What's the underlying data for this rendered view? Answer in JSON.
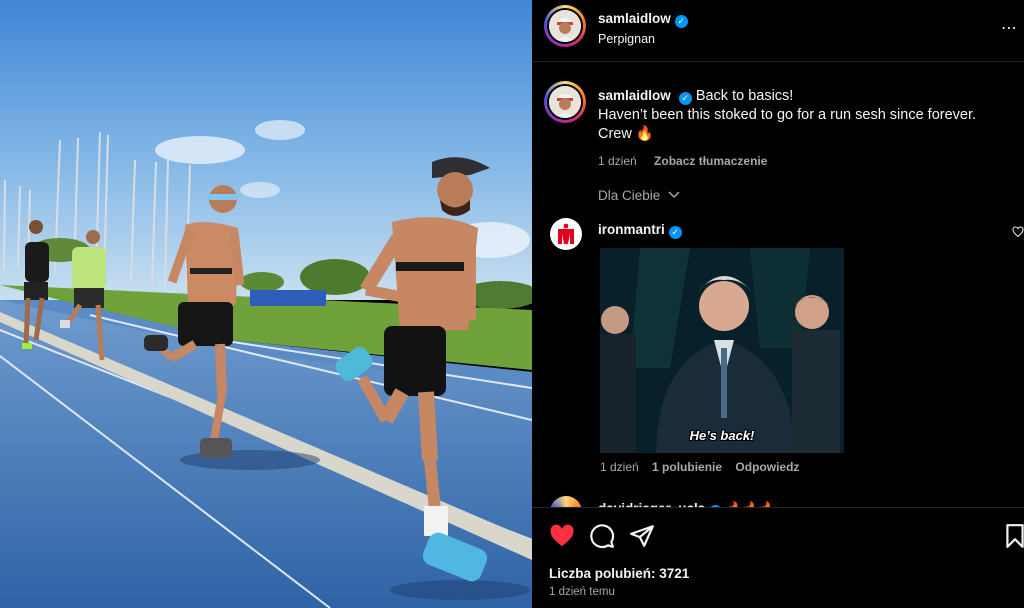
{
  "post": {
    "author": {
      "username": "samlaidlow",
      "verified_mark": "✓",
      "location": "Perpignan"
    },
    "more_icon": "⋯",
    "caption": {
      "line1": "Back to basics!",
      "line2": "Haven’t been this stoked to go for a run sesh since forever.",
      "line3": "Crew 🔥"
    },
    "caption_meta": {
      "time": "1 dzień",
      "translate": "Zobacz tłumaczenie"
    },
    "for_you_label": "Dla Ciebie",
    "comment": {
      "username": "ironmantri",
      "gif_text": "He’s back!",
      "time": "1 dzień",
      "likes": "1 polubienie",
      "reply": "Odpowiedz"
    },
    "partial_comment": {
      "username": "davidrieger_ucla",
      "emoji": "🔥🔥🔥"
    },
    "actions": {
      "liked": true,
      "like_color": "#ff3040"
    },
    "likes_text": "Liczba polubień: 3721",
    "timestamp": "1 dzień temu"
  },
  "colors": {
    "accent_blue": "#0095f6",
    "ironman_red": "#e3001b",
    "track_blue": "#3a6fb0"
  }
}
